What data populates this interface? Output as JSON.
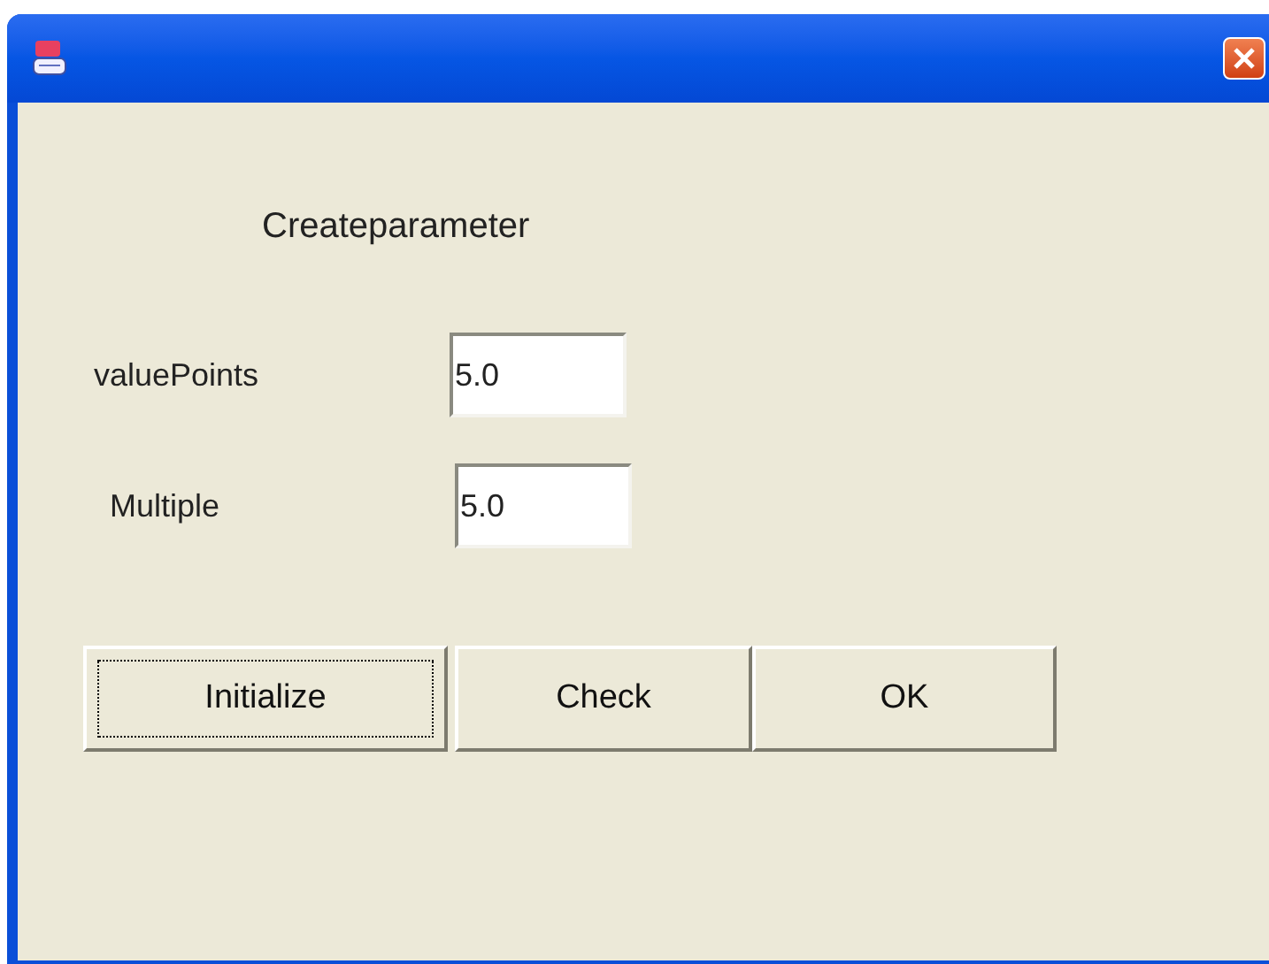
{
  "heading": "Createparameter",
  "fields": [
    {
      "label": "valuePoints",
      "value": "5.0"
    },
    {
      "label": "Multiple",
      "value": "5.0"
    }
  ],
  "buttons": [
    {
      "label": "Initialize",
      "focused": true
    },
    {
      "label": "Check",
      "focused": false
    },
    {
      "label": "OK",
      "focused": false
    }
  ]
}
